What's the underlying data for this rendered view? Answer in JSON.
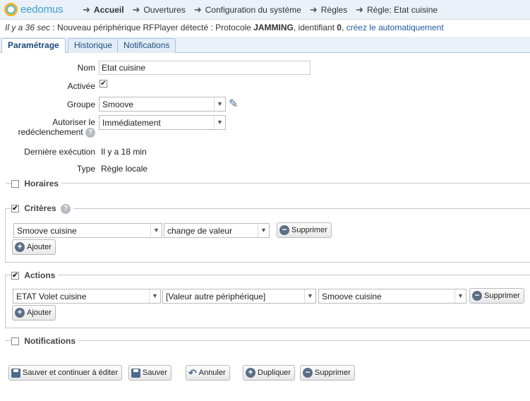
{
  "app": {
    "logo_text": "eedomus"
  },
  "breadcrumb": [
    {
      "label": "Accueil"
    },
    {
      "label": "Ouvertures"
    },
    {
      "label": "Configuration du système"
    },
    {
      "label": "Règles"
    },
    {
      "label": "Règle: Etat cuisine"
    }
  ],
  "notice": {
    "time": "Il y a 36 sec",
    "text_before": " : Nouveau périphérique RFPlayer détecté : Protocole ",
    "protocol": "JAMMING",
    "text_mid": ", identifiant ",
    "id": "0",
    "text_sep": ", ",
    "link": "créez le automatiquement"
  },
  "tabs": [
    {
      "label": "Paramétrage"
    },
    {
      "label": "Historique"
    },
    {
      "label": "Notifications"
    }
  ],
  "form": {
    "nom_label": "Nom",
    "nom_value": "Etat cuisine",
    "activee_label": "Activée",
    "activee_checked": true,
    "groupe_label": "Groupe",
    "groupe_value": "Smoove",
    "autoriser_label_1": "Autoriser le",
    "autoriser_label_2": "redéclenchement",
    "autoriser_value": "Immédiatement",
    "derniere_label": "Dernière exécution",
    "derniere_value": "Il y a 18 min",
    "type_label": "Type",
    "type_value": "Règle locale"
  },
  "sections": {
    "horaires": {
      "title": "Horaires",
      "checked": false
    },
    "criteres": {
      "title": "Critères",
      "checked": true,
      "row": {
        "device": "Smoove cuisine",
        "condition": "change de valeur",
        "delete_label": "Supprimer"
      },
      "add_label": "Ajouter"
    },
    "actions": {
      "title": "Actions",
      "checked": true,
      "row": {
        "device": "ETAT Volet cuisine",
        "value": "[Valeur autre périphérique]",
        "source": "Smoove cuisine",
        "delete_label": "Supprimer"
      },
      "add_label": "Ajouter"
    },
    "notifications": {
      "title": "Notifications",
      "checked": false
    }
  },
  "footer_buttons": {
    "save_continue": "Sauver et continuer à éditer",
    "save": "Sauver",
    "cancel": "Annuler",
    "duplicate": "Dupliquer",
    "delete": "Supprimer"
  }
}
